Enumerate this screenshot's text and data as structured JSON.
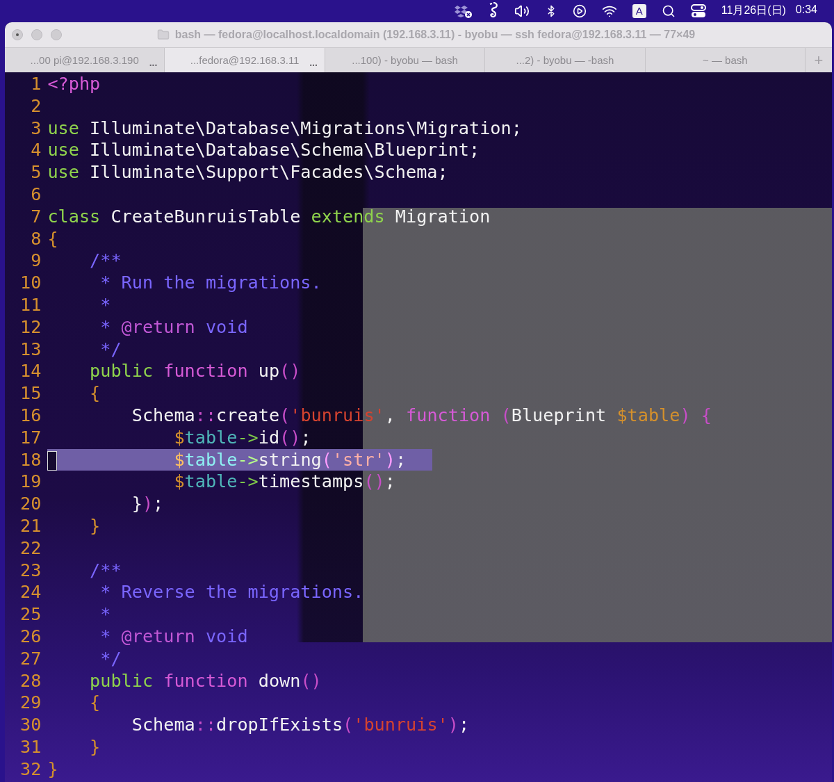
{
  "menu_bar": {
    "input_source": "A",
    "date": "11月26日(日)",
    "time": "0:34"
  },
  "window": {
    "title": "bash — fedora@localhost.localdomain (192.168.3.11) - byobu — ssh fedora@192.168.3.11 — 77×49"
  },
  "tabs": [
    {
      "label": "...00 pi@192.168.3.190",
      "badge": "...",
      "selected": false
    },
    {
      "label": "...fedora@192.168.3.11",
      "badge": "...",
      "selected": true
    },
    {
      "label": "...100) - byobu — bash",
      "selected": false
    },
    {
      "label": "...2) - byobu — -bash",
      "selected": false
    },
    {
      "label": "~ — bash",
      "selected": false
    }
  ],
  "new_tab_button": "+",
  "lines": [
    {
      "number": "1",
      "tokens": [
        {
          "kind": "php",
          "t": "<?php"
        }
      ]
    },
    {
      "number": "2"
    },
    {
      "number": "3",
      "tokens": [
        {
          "kind": "kw",
          "t": "use"
        },
        {
          "kind": "plain",
          "t": " Illuminate\\Database\\Migrations\\Migration;"
        }
      ]
    },
    {
      "number": "4",
      "tokens": [
        {
          "kind": "kw",
          "t": "use"
        },
        {
          "kind": "plain",
          "t": " Illuminate\\Database\\Schema\\Blueprint;"
        }
      ]
    },
    {
      "number": "5",
      "tokens": [
        {
          "kind": "kw",
          "t": "use"
        },
        {
          "kind": "plain",
          "t": " Illuminate\\Support\\Facades\\Schema;"
        }
      ]
    },
    {
      "number": "6"
    },
    {
      "number": "7",
      "tokens": [
        {
          "kind": "kw",
          "t": "class"
        },
        {
          "kind": "plain",
          "t": " CreateBunruisTable "
        },
        {
          "kind": "kw",
          "t": "extends"
        },
        {
          "kind": "plain",
          "t": " Migration"
        }
      ]
    },
    {
      "number": "8",
      "tokens": [
        {
          "kind": "brace",
          "t": "{"
        }
      ]
    },
    {
      "number": "9",
      "tokens": [
        {
          "kind": "comment",
          "t": "    /**"
        }
      ]
    },
    {
      "number": "10",
      "tokens": [
        {
          "kind": "comment",
          "t": "     * Run the migrations."
        }
      ]
    },
    {
      "number": "11",
      "tokens": [
        {
          "kind": "comment",
          "t": "     *"
        }
      ]
    },
    {
      "number": "12",
      "tokens": [
        {
          "kind": "comment",
          "t": "     * "
        },
        {
          "kind": "tag",
          "t": "@return"
        },
        {
          "kind": "comment",
          "t": " void"
        }
      ]
    },
    {
      "number": "13",
      "tokens": [
        {
          "kind": "comment",
          "t": "     */"
        }
      ]
    },
    {
      "number": "14",
      "tokens": [
        {
          "kind": "kw",
          "t": "    public"
        },
        {
          "kind": "fn",
          "t": " function"
        },
        {
          "kind": "plain",
          "t": " up"
        },
        {
          "kind": "paren",
          "t": "()"
        }
      ]
    },
    {
      "number": "15",
      "tokens": [
        {
          "kind": "brace",
          "t": "    {"
        }
      ]
    },
    {
      "number": "16",
      "tokens": [
        {
          "kind": "plain",
          "t": "        Schema"
        },
        {
          "kind": "paren",
          "t": "::"
        },
        {
          "kind": "plain",
          "t": "create"
        },
        {
          "kind": "paren",
          "t": "("
        },
        {
          "kind": "str",
          "t": "'bunruis'"
        },
        {
          "kind": "plain",
          "t": ", "
        },
        {
          "kind": "fn",
          "t": "function"
        },
        {
          "kind": "paren",
          "t": " ("
        },
        {
          "kind": "plain",
          "t": "Blueprint "
        },
        {
          "kind": "dollar",
          "t": "$table"
        },
        {
          "kind": "paren",
          "t": ")"
        },
        {
          "kind": "paren",
          "t": " {"
        }
      ]
    },
    {
      "number": "17",
      "tokens": [
        {
          "kind": "dollar",
          "t": "            $"
        },
        {
          "kind": "var",
          "t": "table"
        },
        {
          "kind": "arrow",
          "t": "->"
        },
        {
          "kind": "plain",
          "t": "id"
        },
        {
          "kind": "paren",
          "t": "()"
        },
        {
          "kind": "plain",
          "t": ";"
        }
      ]
    },
    {
      "number": "18",
      "selected": true,
      "cursor": true,
      "tokens": [
        {
          "kind": "dollar",
          "t": "            $"
        },
        {
          "kind": "var",
          "t": "table"
        },
        {
          "kind": "arrow",
          "t": "->"
        },
        {
          "kind": "plain",
          "t": "string"
        },
        {
          "kind": "paren",
          "t": "("
        },
        {
          "kind": "str",
          "t": "'str'"
        },
        {
          "kind": "paren",
          "t": ")"
        },
        {
          "kind": "plain",
          "t": ";"
        }
      ]
    },
    {
      "number": "19",
      "tokens": [
        {
          "kind": "dollar",
          "t": "            $"
        },
        {
          "kind": "var",
          "t": "table"
        },
        {
          "kind": "arrow",
          "t": "->"
        },
        {
          "kind": "plain",
          "t": "timestamps"
        },
        {
          "kind": "paren",
          "t": "()"
        },
        {
          "kind": "plain",
          "t": ";"
        }
      ]
    },
    {
      "number": "20",
      "tokens": [
        {
          "kind": "plain",
          "t": "        }"
        },
        {
          "kind": "paren",
          "t": ")"
        },
        {
          "kind": "plain",
          "t": ";"
        }
      ]
    },
    {
      "number": "21",
      "tokens": [
        {
          "kind": "brace",
          "t": "    }"
        }
      ]
    },
    {
      "number": "22"
    },
    {
      "number": "23",
      "tokens": [
        {
          "kind": "comment",
          "t": "    /**"
        }
      ]
    },
    {
      "number": "24",
      "tokens": [
        {
          "kind": "comment",
          "t": "     * Reverse the migrations."
        }
      ]
    },
    {
      "number": "25",
      "tokens": [
        {
          "kind": "comment",
          "t": "     *"
        }
      ]
    },
    {
      "number": "26",
      "tokens": [
        {
          "kind": "comment",
          "t": "     * "
        },
        {
          "kind": "tag",
          "t": "@return"
        },
        {
          "kind": "comment",
          "t": " void"
        }
      ]
    },
    {
      "number": "27",
      "tokens": [
        {
          "kind": "comment",
          "t": "     */"
        }
      ]
    },
    {
      "number": "28",
      "tokens": [
        {
          "kind": "kw",
          "t": "    public"
        },
        {
          "kind": "fn",
          "t": " function"
        },
        {
          "kind": "plain",
          "t": " down"
        },
        {
          "kind": "paren",
          "t": "()"
        }
      ]
    },
    {
      "number": "29",
      "tokens": [
        {
          "kind": "brace",
          "t": "    {"
        }
      ]
    },
    {
      "number": "30",
      "tokens": [
        {
          "kind": "plain",
          "t": "        Schema"
        },
        {
          "kind": "paren",
          "t": "::"
        },
        {
          "kind": "plain",
          "t": "dropIfExists"
        },
        {
          "kind": "paren",
          "t": "("
        },
        {
          "kind": "str",
          "t": "'bunruis'"
        },
        {
          "kind": "paren",
          "t": ")"
        },
        {
          "kind": "plain",
          "t": ";"
        }
      ]
    },
    {
      "number": "31",
      "tokens": [
        {
          "kind": "brace",
          "t": "    }"
        }
      ]
    },
    {
      "number": "32",
      "tokens": [
        {
          "kind": "brace",
          "t": "}"
        }
      ]
    }
  ]
}
